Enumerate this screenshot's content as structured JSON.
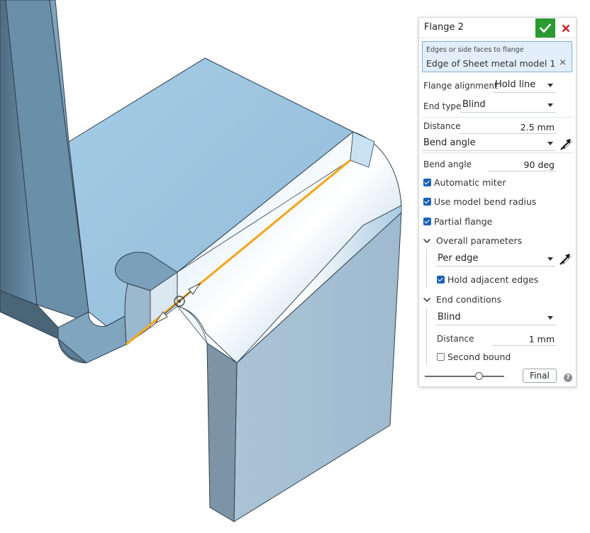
{
  "dialog": {
    "title": "Flange 2",
    "selection": {
      "label": "Edges or side faces to flange",
      "value": "Edge of Sheet metal model 1",
      "clear_icon": "×"
    },
    "flange_alignment": {
      "label": "Flange alignment",
      "value": "Hold line"
    },
    "end_type": {
      "label": "End type",
      "value": "Blind"
    },
    "distance": {
      "label": "Distance",
      "value": "2.5 mm"
    },
    "bend_mode": {
      "value": "Bend angle"
    },
    "bend_angle": {
      "label": "Bend angle",
      "value": "90 deg"
    },
    "checkboxes": {
      "automatic_miter": {
        "label": "Automatic miter",
        "checked": true
      },
      "use_model_bend_radius": {
        "label": "Use model bend radius",
        "checked": true
      },
      "partial_flange": {
        "label": "Partial flange",
        "checked": true
      }
    },
    "overall_parameters": {
      "label": "Overall parameters",
      "mode": "Per edge",
      "hold_adjacent_edges": {
        "label": "Hold adjacent edges",
        "checked": true
      }
    },
    "end_conditions": {
      "label": "End conditions",
      "type": "Blind",
      "distance": {
        "label": "Distance",
        "value": "1 mm"
      },
      "second_bound": {
        "label": "Second bound",
        "checked": false
      }
    },
    "final_button": "Final",
    "help_icon": "?"
  },
  "icons": {
    "confirm": "checkmark-icon",
    "cancel": "close-icon",
    "flip": "flip-direction-icon",
    "help": "help-icon"
  },
  "colors": {
    "confirm_green": "#2a9a31",
    "cancel_red": "#c8202c",
    "selection_fill": "#e2eef9",
    "highlight_edge": "#f2a823",
    "model_face_top": "#9fc6e0",
    "model_face_dark": "#5b7f98"
  }
}
